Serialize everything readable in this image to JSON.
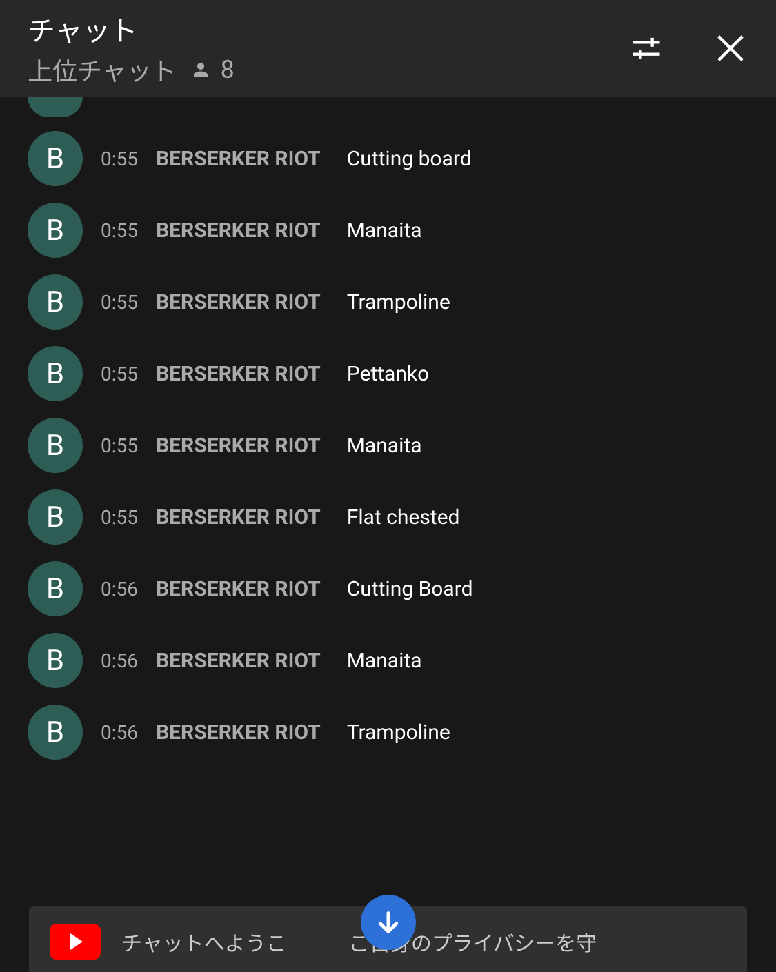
{
  "header": {
    "title": "チャット",
    "subtitle": "上位チャット",
    "viewer_count": "8"
  },
  "avatar_letter": "B",
  "messages": [
    {
      "time": "0:55",
      "user": "BERSERKER RIOT",
      "text": "Cutting board"
    },
    {
      "time": "0:55",
      "user": "BERSERKER RIOT",
      "text": "Manaita"
    },
    {
      "time": "0:55",
      "user": "BERSERKER RIOT",
      "text": "Trampoline"
    },
    {
      "time": "0:55",
      "user": "BERSERKER RIOT",
      "text": "Pettanko"
    },
    {
      "time": "0:55",
      "user": "BERSERKER RIOT",
      "text": "Manaita"
    },
    {
      "time": "0:55",
      "user": "BERSERKER RIOT",
      "text": "Flat chested"
    },
    {
      "time": "0:56",
      "user": "BERSERKER RIOT",
      "text": "Cutting Board"
    },
    {
      "time": "0:56",
      "user": "BERSERKER RIOT",
      "text": "Manaita"
    },
    {
      "time": "0:56",
      "user": "BERSERKER RIOT",
      "text": "Trampoline"
    }
  ],
  "footer": {
    "welcome_text": "チャットへようこ　　　ご自身のプライバシーを守"
  }
}
